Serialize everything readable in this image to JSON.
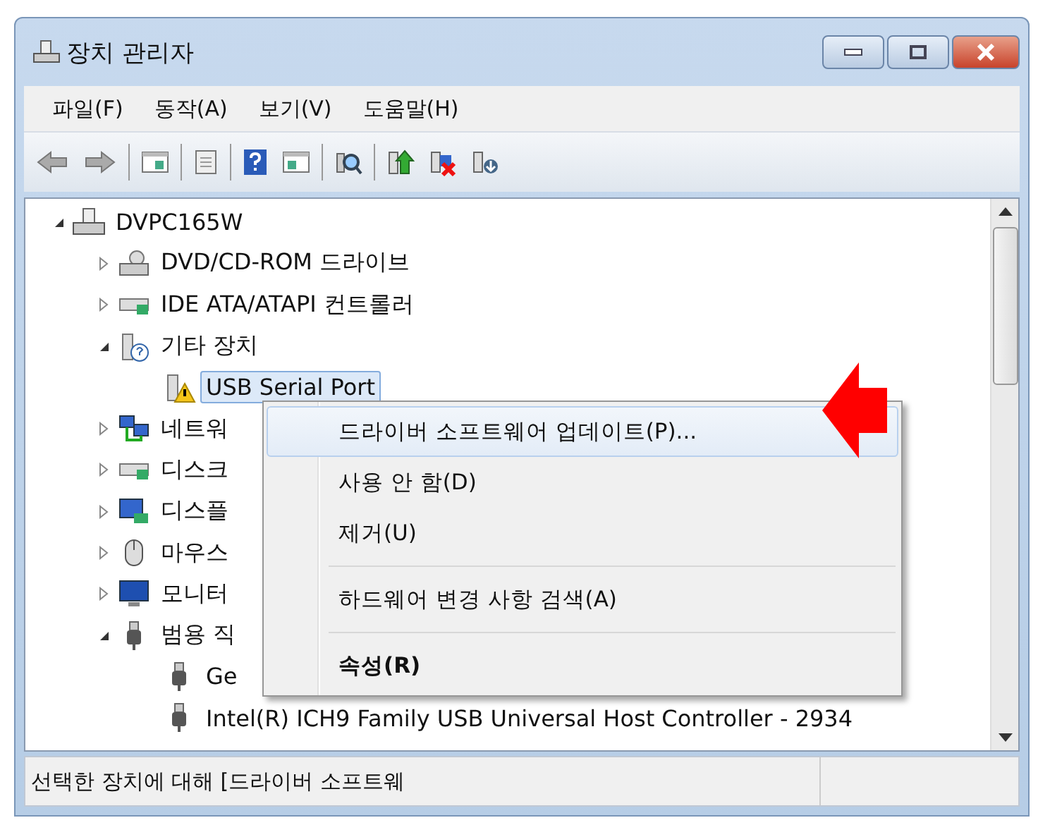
{
  "window": {
    "title": "장치 관리자"
  },
  "menu_bar": [
    "파일(F)",
    "동작(A)",
    "보기(V)",
    "도움말(H)"
  ],
  "tree": [
    {
      "label": "DVPC165W",
      "kind": "computer",
      "expanded": true,
      "selected": false,
      "children": [
        {
          "label": "DVD/CD-ROM 드라이브",
          "kind": "drive",
          "expanded": false,
          "selected": false
        },
        {
          "label": "IDE ATA/ATAPI 컨트롤러",
          "kind": "controller",
          "expanded": false,
          "selected": false
        },
        {
          "label": "기타 장치",
          "kind": "unknown",
          "expanded": true,
          "selected": false,
          "children": [
            {
              "label": "USB Serial Port",
              "kind": "warning",
              "selected": true
            }
          ]
        },
        {
          "label": "네트워",
          "kind": "network",
          "expanded": false,
          "selected": false
        },
        {
          "label": "디스크",
          "kind": "controller",
          "expanded": false,
          "selected": false
        },
        {
          "label": "디스플",
          "kind": "display",
          "expanded": false,
          "selected": false
        },
        {
          "label": "마우스",
          "kind": "mouse",
          "expanded": false,
          "selected": false
        },
        {
          "label": "모니터",
          "kind": "monitor",
          "expanded": false,
          "selected": false
        },
        {
          "label": "범용 직",
          "kind": "usb",
          "expanded": true,
          "selected": false,
          "children": [
            {
              "label": "Ge",
              "kind": "usb",
              "selected": false
            },
            {
              "label": "Intel(R) ICH9 Family USB Universal Host Controller - 2934",
              "kind": "usb",
              "selected": false
            }
          ]
        }
      ]
    }
  ],
  "context_menu": [
    {
      "label": "드라이버 소프트웨어 업데이트(P)...",
      "selected": true,
      "default": false,
      "separator_after": false
    },
    {
      "label": "사용 안 함(D)",
      "selected": false,
      "default": false,
      "separator_after": false
    },
    {
      "label": "제거(U)",
      "selected": false,
      "default": false,
      "separator_after": true
    },
    {
      "label": "하드웨어 변경 사항 검색(A)",
      "selected": false,
      "default": false,
      "separator_after": true
    },
    {
      "label": "속성(R)",
      "selected": false,
      "default": true,
      "separator_after": false
    }
  ],
  "status_bar": "선택한 장치에 대해 [드라이버 소프트웨"
}
